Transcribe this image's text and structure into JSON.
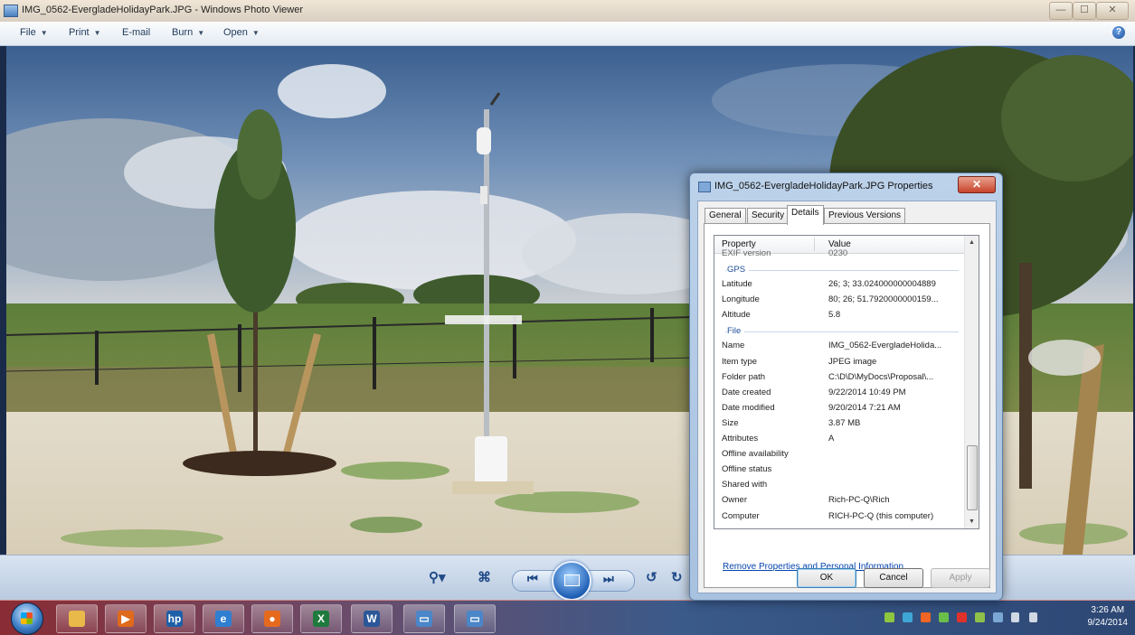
{
  "window": {
    "title": "IMG_0562-EvergladeHolidayPark.JPG - Windows Photo Viewer",
    "minimize": "—",
    "maximize": "☐",
    "close": "✕"
  },
  "menu": {
    "file": "File",
    "print": "Print",
    "email": "E-mail",
    "burn": "Burn",
    "open": "Open",
    "help": "?"
  },
  "viewer_controls": {
    "zoom_icon": "zoom-icon",
    "actual_size_icon": "actual-size-icon",
    "previous_icon": "previous-icon",
    "slideshow_icon": "slideshow-icon",
    "next_icon": "next-icon",
    "rotate_ccw_icon": "rotate-ccw-icon",
    "rotate_cw_icon": "rotate-cw-icon"
  },
  "dialog": {
    "title": "IMG_0562-EvergladeHolidayPark.JPG Properties",
    "close": "✕",
    "tabs": [
      "General",
      "Security",
      "Details",
      "Previous Versions"
    ],
    "active_tab": "Details",
    "columns": {
      "property": "Property",
      "value": "Value"
    },
    "partial_row": {
      "property": "EXIF version",
      "value": "0230"
    },
    "groups": {
      "gps": {
        "label": "GPS",
        "rows": [
          {
            "property": "Latitude",
            "value": "26; 3; 33.024000000004889"
          },
          {
            "property": "Longitude",
            "value": "80; 26; 51.7920000000159..."
          },
          {
            "property": "Altitude",
            "value": "5.8"
          }
        ]
      },
      "file": {
        "label": "File",
        "rows": [
          {
            "property": "Name",
            "value": "IMG_0562-EvergladeHolida..."
          },
          {
            "property": "Item type",
            "value": "JPEG image"
          },
          {
            "property": "Folder path",
            "value": "C:\\D\\D\\MyDocs\\Proposal\\..."
          },
          {
            "property": "Date created",
            "value": "9/22/2014 10:49 PM"
          },
          {
            "property": "Date modified",
            "value": "9/20/2014 7:21 AM"
          },
          {
            "property": "Size",
            "value": "3.87 MB"
          },
          {
            "property": "Attributes",
            "value": "A"
          },
          {
            "property": "Offline availability",
            "value": ""
          },
          {
            "property": "Offline status",
            "value": ""
          },
          {
            "property": "Shared with",
            "value": ""
          },
          {
            "property": "Owner",
            "value": "Rich-PC-Q\\Rich"
          },
          {
            "property": "Computer",
            "value": "RICH-PC-Q (this computer)"
          }
        ]
      }
    },
    "remove_link": "Remove Properties and Personal Information",
    "buttons": {
      "ok": "OK",
      "cancel": "Cancel",
      "apply": "Apply"
    }
  },
  "taskbar": {
    "apps": [
      {
        "name": "windows-explorer",
        "glyph": "",
        "color": "#e9b949"
      },
      {
        "name": "media-player",
        "glyph": "▶",
        "color": "#e06a1c"
      },
      {
        "name": "hp-app",
        "glyph": "hp",
        "color": "#1d5fa8"
      },
      {
        "name": "internet-explorer",
        "glyph": "e",
        "color": "#2f7fd1"
      },
      {
        "name": "firefox",
        "glyph": "●",
        "color": "#e66a1e"
      },
      {
        "name": "excel",
        "glyph": "X",
        "color": "#1f7a3e"
      },
      {
        "name": "word",
        "glyph": "W",
        "color": "#2b5797"
      },
      {
        "name": "photo-viewer",
        "glyph": "▭",
        "color": "#4a86c8"
      },
      {
        "name": "photo-viewer-2",
        "glyph": "▭",
        "color": "#4a86c8"
      }
    ],
    "clock_time": "3:26 AM",
    "clock_date": "9/24/2014"
  }
}
